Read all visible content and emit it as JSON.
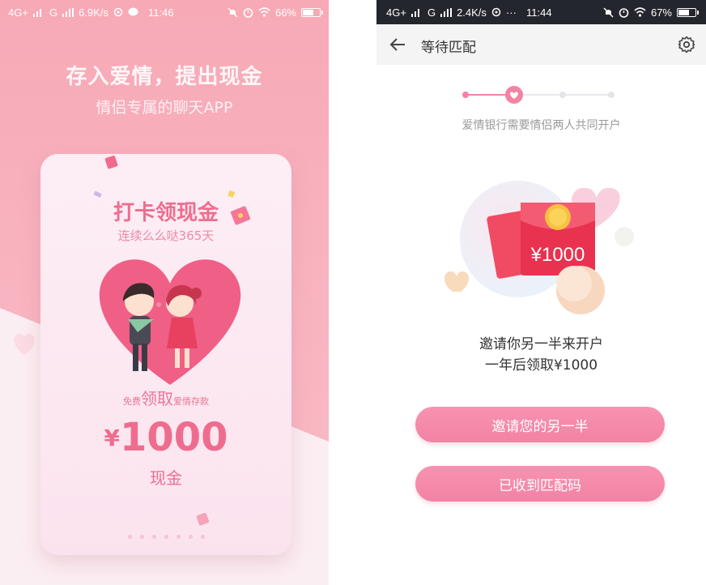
{
  "left": {
    "status": {
      "network": "4G+",
      "network2": "G",
      "speed": "6.9K/s",
      "time": "11:46",
      "battery": "66%",
      "battery_level": 0.66
    },
    "title": "存入爱情，提出现金",
    "subtitle": "情侣专属的聊天APP",
    "card": {
      "title": "打卡领现金",
      "subtitle": "连续么么哒365天",
      "free_prefix": "免费",
      "free_big": "领取",
      "free_suffix": "爱情存款",
      "currency": "¥",
      "amount": "1000",
      "cash": "现金"
    }
  },
  "right": {
    "status": {
      "network": "4G+",
      "network2": "G",
      "speed": "2.4K/s",
      "more": "···",
      "time": "11:44",
      "battery": "67%",
      "battery_level": 0.67
    },
    "nav_title": "等待匹配",
    "step_hint": "爱情银行需要情侣两人共同开户",
    "steps_total": 4,
    "steps_current": 2,
    "envelope_amount": "¥1000",
    "invite_line1": "邀请你另一半来开户",
    "invite_line2": "一年后领取¥1000",
    "buttons": {
      "invite": "邀请您的另一半",
      "received": "已收到匹配码"
    }
  },
  "icons": {
    "back": "back-arrow-icon",
    "settings": "gear-icon",
    "signal": "signal-icon",
    "wifi": "wifi-icon",
    "alarm": "alarm-icon",
    "mute": "mute-icon",
    "battery": "battery-icon"
  },
  "colors": {
    "pink_bg": "#f7a9b6",
    "accent": "#ee6d8f",
    "button": "#f283a5",
    "statusbar_dark": "#23262c"
  }
}
